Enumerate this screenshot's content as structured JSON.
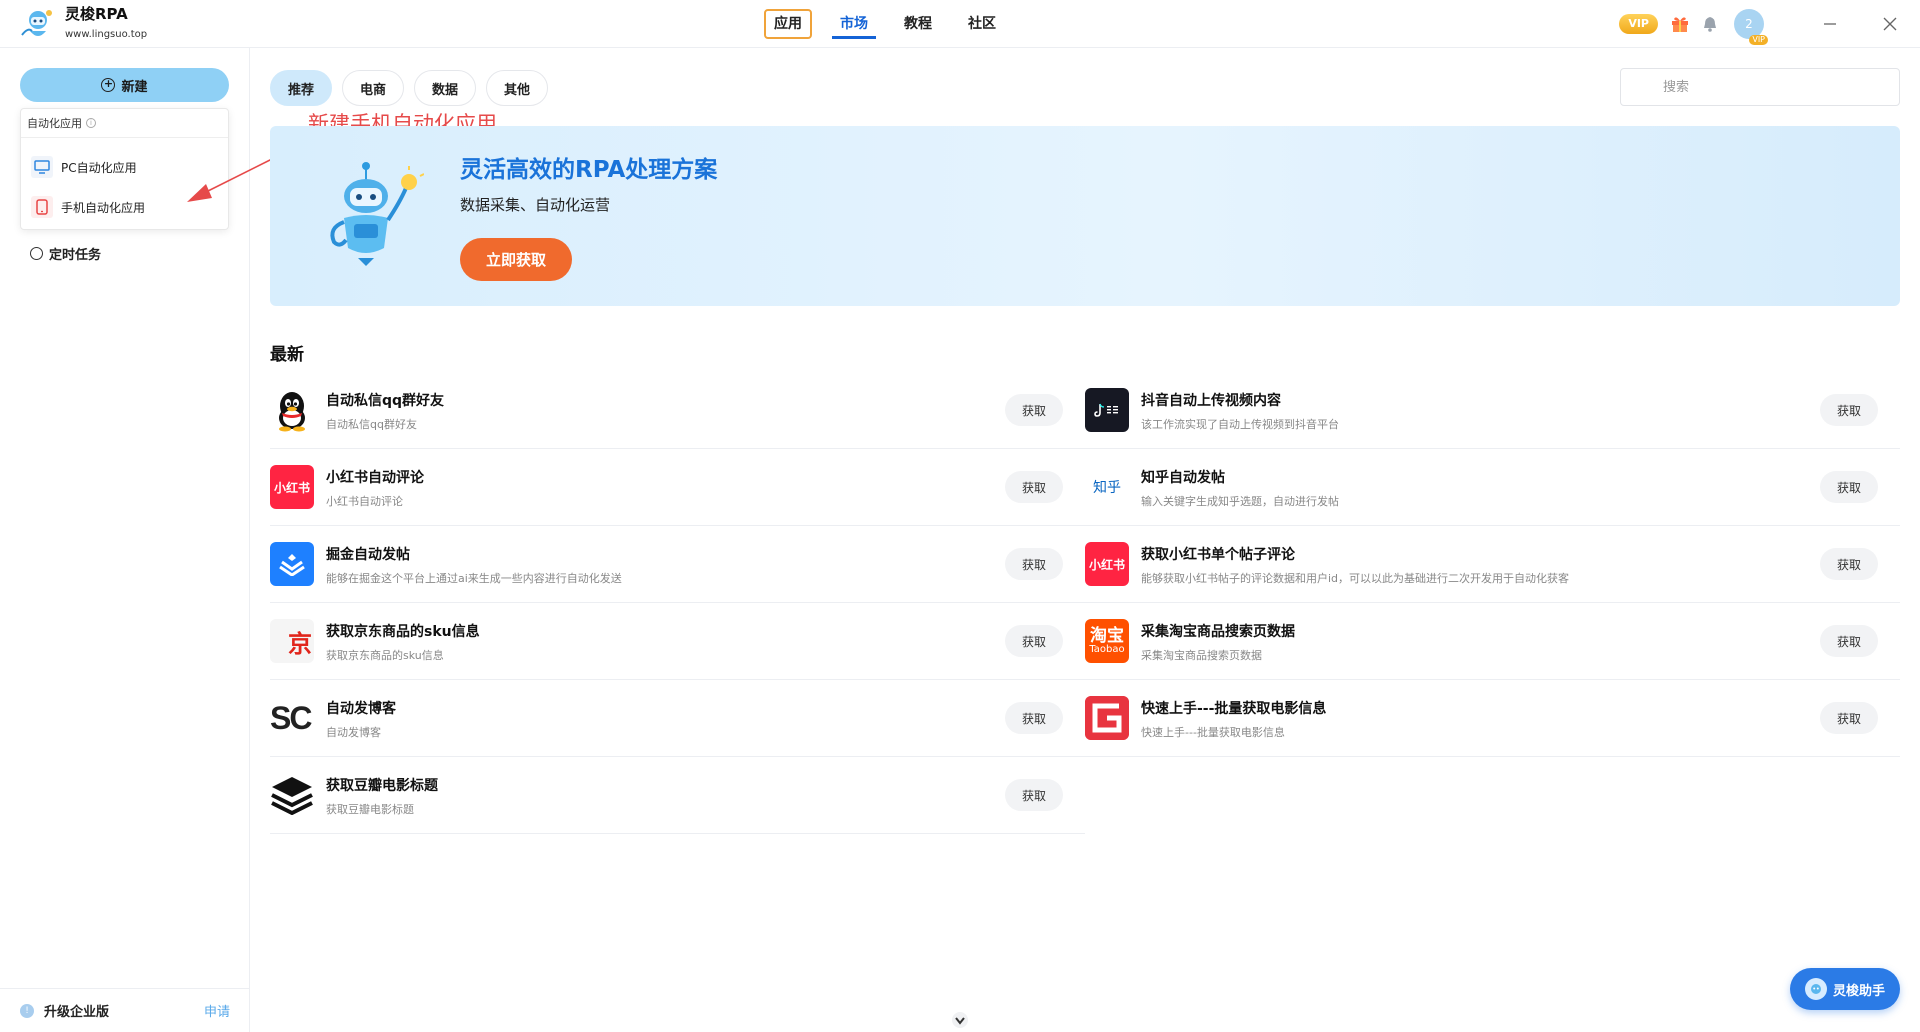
{
  "app": {
    "name": "灵梭RPA",
    "url": "www.lingsuo.top"
  },
  "nav": {
    "items": [
      {
        "label": "应用",
        "state": "boxed"
      },
      {
        "label": "市场",
        "state": "active"
      },
      {
        "label": "教程",
        "state": "normal"
      },
      {
        "label": "社区",
        "state": "normal"
      }
    ]
  },
  "topbar": {
    "vip_label": "VIP",
    "avatar_badge": "VIP",
    "avatar_initial": "2"
  },
  "sidebar": {
    "new_label": "新建",
    "dropdown_title": "自动化应用",
    "dropdown_items": [
      {
        "label": "PC自动化应用",
        "icon": "monitor-icon"
      },
      {
        "label": "手机自动化应用",
        "icon": "phone-icon"
      }
    ],
    "schedule_label": "定时任务",
    "upgrade_label": "升级企业版",
    "apply_link": "申请"
  },
  "annotation": {
    "text": "新建手机自动化应用",
    "color": "#e64a4a"
  },
  "tabs": [
    "推荐",
    "电商",
    "数据",
    "其他"
  ],
  "search": {
    "placeholder": "搜索"
  },
  "banner": {
    "title": "灵活高效的RPA处理方案",
    "subtitle": "数据采集、自动化运营",
    "button": "立即获取"
  },
  "section_title": "最新",
  "get_label": "获取",
  "apps_left": [
    {
      "name": "自动私信qq群好友",
      "desc": "自动私信qq群好友",
      "icon": "qq-icon"
    },
    {
      "name": "小红书自动评论",
      "desc": "小红书自动评论",
      "icon": "xiaohongshu-icon",
      "icon_text": "小红书"
    },
    {
      "name": "掘金自动发帖",
      "desc": "能够在掘金这个平台上通过ai来生成一些内容进行自动化发送",
      "icon": "juejin-icon"
    },
    {
      "name": "获取京东商品的sku信息",
      "desc": "获取京东商品的sku信息",
      "icon": "jd-icon",
      "icon_text": "京"
    },
    {
      "name": "自动发博客",
      "desc": "自动发博客",
      "icon": "csdn-icon",
      "icon_text": "SC"
    },
    {
      "name": "获取豆瓣电影标题",
      "desc": "获取豆瓣电影标题",
      "icon": "layers-icon"
    }
  ],
  "apps_right": [
    {
      "name": "抖音自动上传视频内容",
      "desc": "该工作流实现了自动上传视频到抖音平台",
      "icon": "douyin-icon"
    },
    {
      "name": "知乎自动发帖",
      "desc": "输入关键字生成知乎选题，自动进行发帖",
      "icon": "zhihu-icon",
      "icon_text": "知乎"
    },
    {
      "name": "获取小红书单个帖子评论",
      "desc": "能够获取小红书帖子的评论数据和用户id，可以以此为基础进行二次开发用于自动化获客",
      "icon": "xiaohongshu-icon",
      "icon_text": "小红书"
    },
    {
      "name": "采集淘宝商品搜索页数据",
      "desc": "采集淘宝商品搜索页数据",
      "icon": "taobao-icon",
      "icon_text": "淘宝",
      "icon_sub": "Taobao"
    },
    {
      "name": "快速上手---批量获取电影信息",
      "desc": "快速上手---批量获取电影信息",
      "icon": "g-logo-icon",
      "icon_text": "G"
    }
  ],
  "assistant_label": "灵梭助手",
  "colors": {
    "accent": "#1463d6",
    "banner_button": "#f06a2d",
    "tab_active": "#cfe9fb",
    "new_button": "#8fd0f5",
    "xiaohongshu": "#ff2442"
  }
}
